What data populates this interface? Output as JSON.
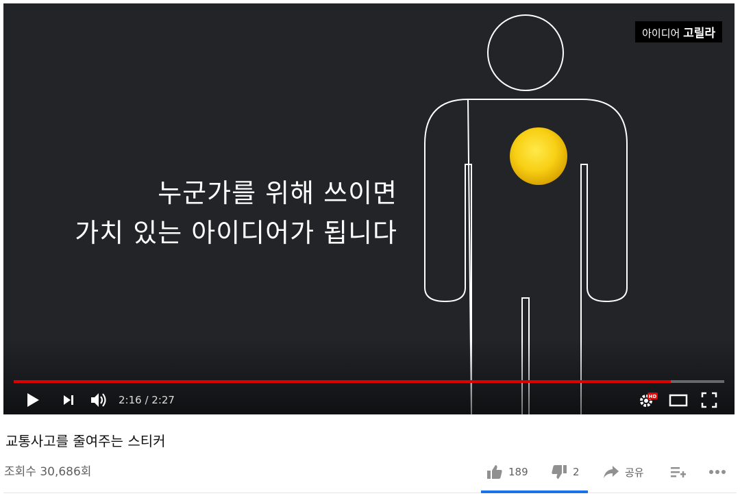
{
  "player": {
    "caption_line1": "누군가를 위해 쓰이면",
    "caption_line2": "가치 있는 아이디어가 됩니다",
    "watermark_prefix": "아이디어",
    "watermark_brand": "고릴라",
    "progress_fraction": 0.925,
    "current_time": "2:16",
    "duration": "2:27",
    "time_display": "2:16 / 2:27",
    "hd_badge": "HD",
    "accent_color": "#e00000"
  },
  "video": {
    "title": "교통사고를 줄여주는 스티커",
    "views": "조회수 30,686회"
  },
  "actions": {
    "like_count": "189",
    "dislike_count": "2",
    "share_label": "공유",
    "like_ratio": 0.99
  }
}
